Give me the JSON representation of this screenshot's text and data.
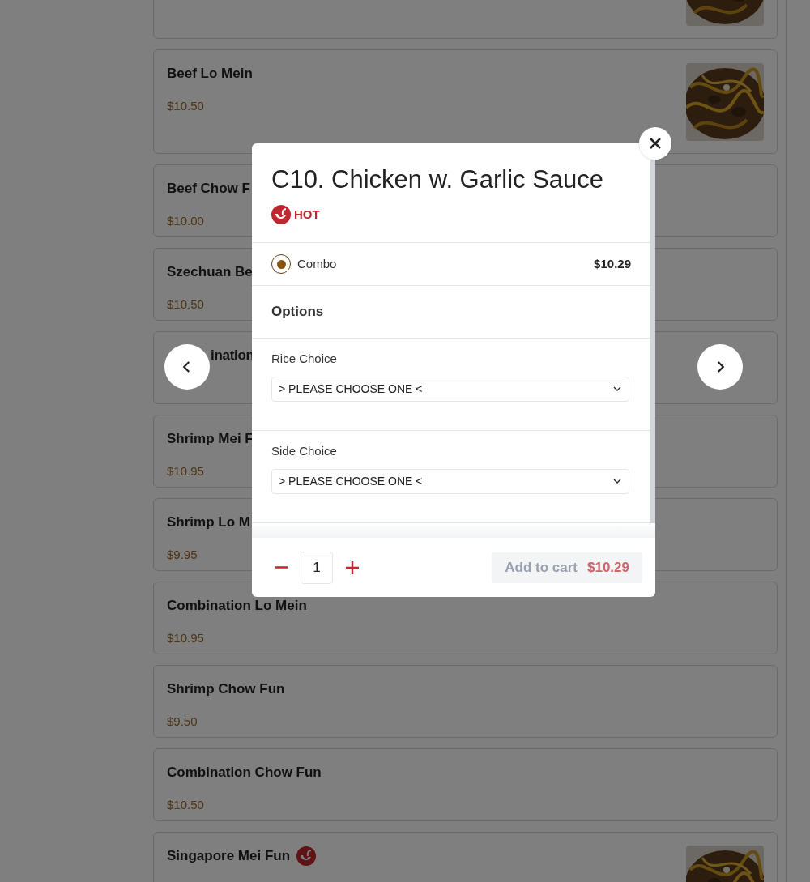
{
  "menu_items": [
    {
      "kind": "full",
      "image": true
    },
    {
      "kind": "full",
      "name": "Beef Lo Mein",
      "price": "$10.50",
      "image": true,
      "hot": false
    },
    {
      "kind": "full",
      "name": "Beef Chow F",
      "price": "$10.00",
      "image": false
    },
    {
      "kind": "full",
      "name": "Szechuan Be",
      "price": "$10.50",
      "image": false
    },
    {
      "kind": "partly-hidden",
      "name": "ination",
      "image": false
    },
    {
      "kind": "full",
      "name": "Shrimp Mei F",
      "price": "$10.95",
      "image": false
    },
    {
      "kind": "full",
      "name": "Shrimp Lo M",
      "price": "$9.95",
      "image": false
    },
    {
      "kind": "full",
      "name": "Combination Lo Mein",
      "price": "$10.95",
      "image": false,
      "hot": false
    },
    {
      "kind": "full",
      "name": "Shrimp Chow Fun",
      "price": "$9.50",
      "image": false,
      "hot": false
    },
    {
      "kind": "full",
      "name": "Combination Chow Fun",
      "price": "$10.50",
      "image": false,
      "hot": false
    },
    {
      "kind": "full",
      "name": "Singapore Mei Fun",
      "image": true,
      "hot": true
    }
  ],
  "modal": {
    "title": "C10. Chicken w. Garlic Sauce",
    "hot_label": "HOT",
    "sizes": [
      {
        "label": "Combo",
        "price": "$10.29",
        "selected": true
      }
    ],
    "options_heading": "Options",
    "options": [
      {
        "label": "Rice Choice",
        "value": "> PLEASE CHOOSE ONE <"
      },
      {
        "label": "Side Choice",
        "value": "> PLEASE CHOOSE ONE <"
      }
    ],
    "quantity": "1",
    "add_button": {
      "label": "Add to cart",
      "price": "$10.29",
      "disabled": true
    }
  }
}
